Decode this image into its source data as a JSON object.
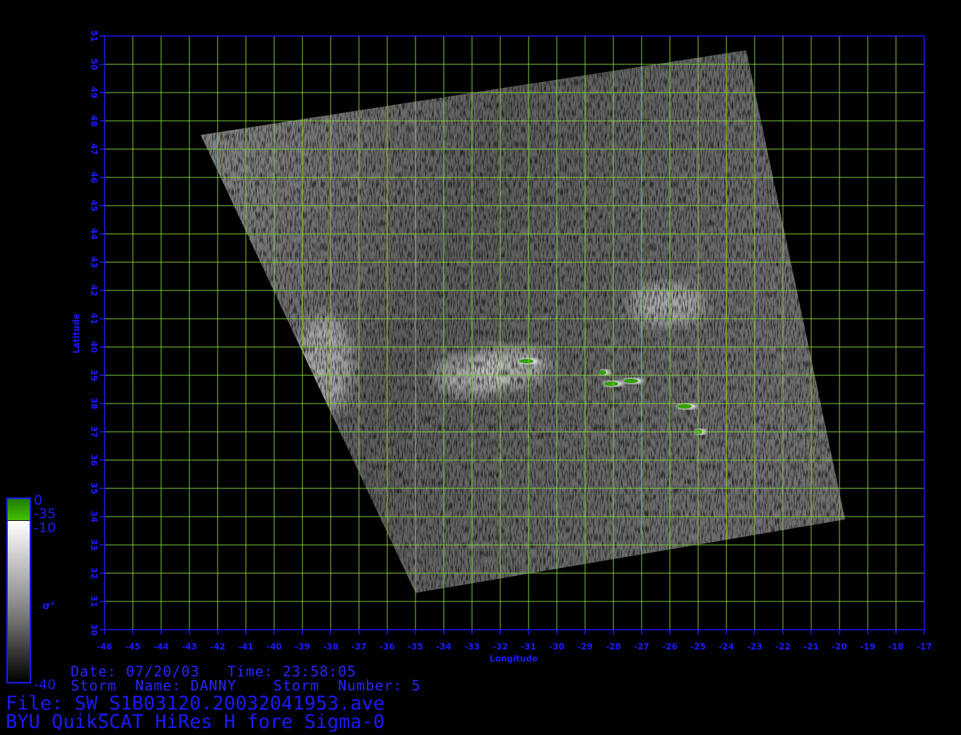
{
  "colors": {
    "axis": "#1a1aff",
    "grid": "#7fd13a",
    "background": "#000000",
    "colorbar_green": "#2ea000"
  },
  "map": {
    "lon_range": [
      -46,
      -17
    ],
    "lat_range": [
      30,
      51
    ],
    "lon_ticks": [
      "-46",
      "-45",
      "-44",
      "-43",
      "-42",
      "-41",
      "-40",
      "-39",
      "-38",
      "-37",
      "-36",
      "-35",
      "-34",
      "-33",
      "-32",
      "-31",
      "-30",
      "-29",
      "-28",
      "-27",
      "-26",
      "-25",
      "-24",
      "-23",
      "-22",
      "-21",
      "-20",
      "-19",
      "-18",
      "-17"
    ],
    "lat_ticks": [
      "30",
      "31",
      "32",
      "33",
      "34",
      "35",
      "36",
      "37",
      "38",
      "39",
      "40",
      "41",
      "42",
      "43",
      "44",
      "45",
      "46",
      "47",
      "48",
      "49",
      "50",
      "51"
    ],
    "xlabel": "Longitude",
    "ylabel": "Latitude",
    "swath_corners_lonlat": [
      [
        -42.6,
        47.5
      ],
      [
        -23.3,
        50.5
      ],
      [
        -19.8,
        33.9
      ],
      [
        -35.0,
        31.3
      ]
    ],
    "green_patches_lonlat": [
      [
        -31.0,
        39.5
      ],
      [
        -28.0,
        38.7
      ],
      [
        -27.3,
        38.8
      ],
      [
        -25.4,
        37.9
      ],
      [
        -28.3,
        39.1
      ],
      [
        -24.9,
        37.0
      ]
    ],
    "bright_patches_lonlat": [
      [
        -38.2,
        39.4
      ],
      [
        -26.1,
        41.5
      ],
      [
        -33.0,
        39.0
      ],
      [
        -31.6,
        39.3
      ]
    ]
  },
  "colorbar": {
    "label": "σ°",
    "tick_0": "0",
    "tick_m35": "-35",
    "tick_m10": "-10",
    "tick_m40": "-40"
  },
  "footer": {
    "date_time": "Date: 07/20/03   Time: 23:58:05",
    "storm": "Storm  Name: DANNY    Storm  Number: 5",
    "file": "File: SW_S1B03120.20032041953.ave",
    "title": "BYU QuikSCAT HiRes H fore Sigma-0"
  }
}
